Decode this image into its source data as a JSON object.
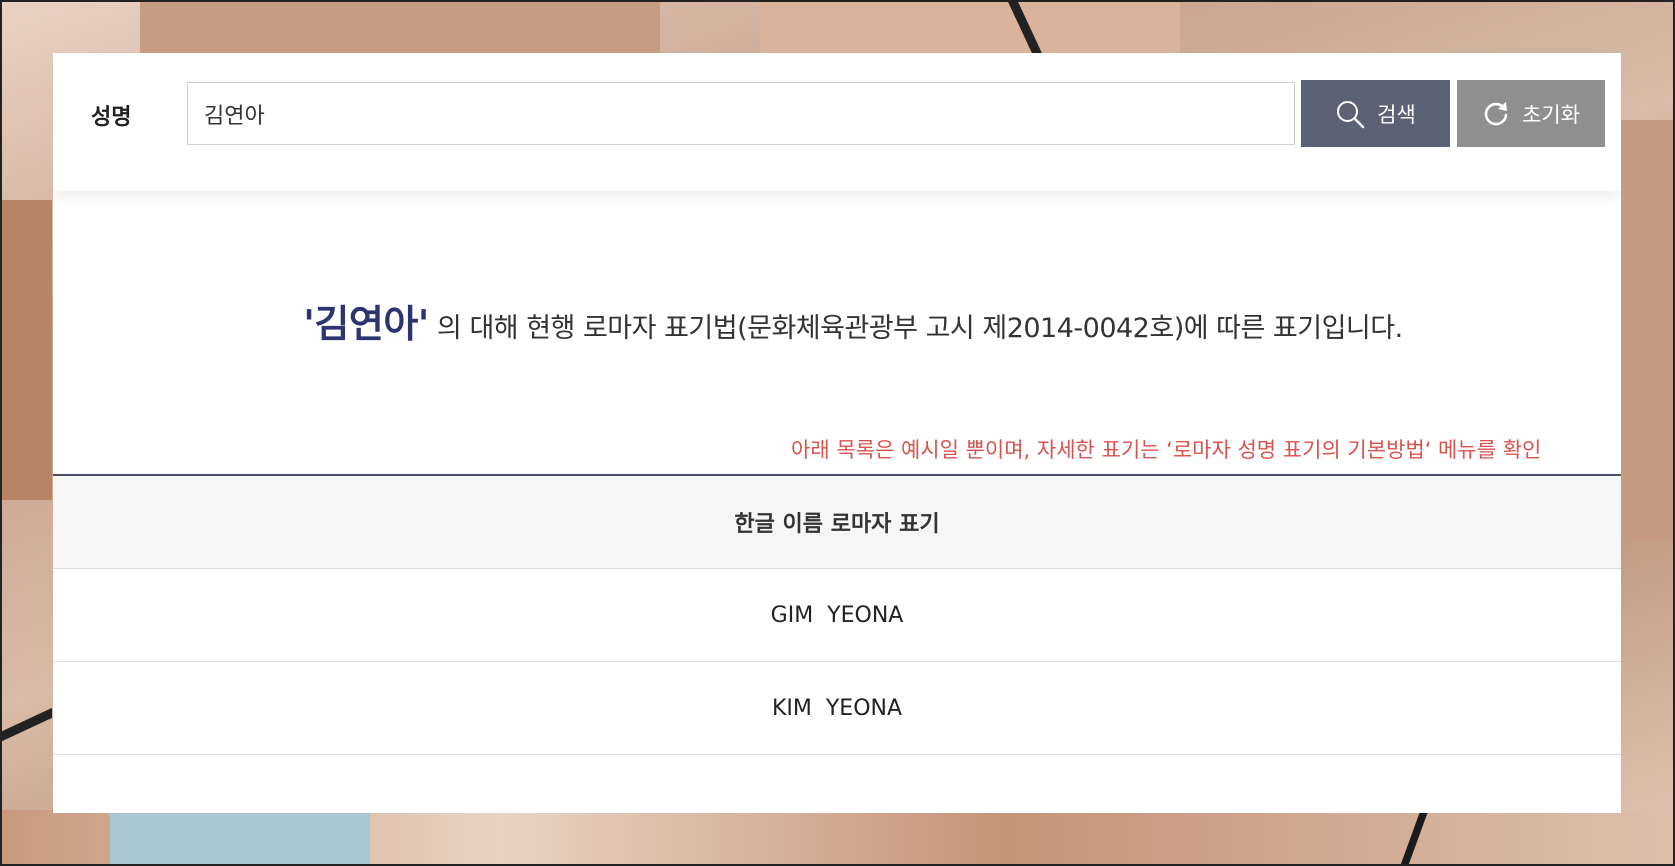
{
  "search": {
    "label": "성명",
    "value": "김연아",
    "search_button_label": "검색",
    "reset_button_label": "초기화"
  },
  "result": {
    "name_quoted": "'김연아'",
    "message_rest": " 의 대해 현행 로마자 표기법(문화체육관광부 고시 제2014-0042호)에 따른 표기입니다.",
    "notice": "아래 목록은 예시일 뿐이며, 자세한 표기는 ‘로마자 성명 표기의 기본방법‘ 메뉴를 확인"
  },
  "table": {
    "header": "한글 이름 로마자 표기",
    "rows": [
      "GIM  YEONA",
      "KIM  YEONA"
    ]
  },
  "colors": {
    "accent_name": "#2d3470",
    "notice": "#d9534f",
    "search_button": "#5c6276",
    "reset_button": "#8f8f8f"
  },
  "icons": {
    "search_button_icon": "search-icon",
    "reset_button_icon": "refresh-icon"
  }
}
